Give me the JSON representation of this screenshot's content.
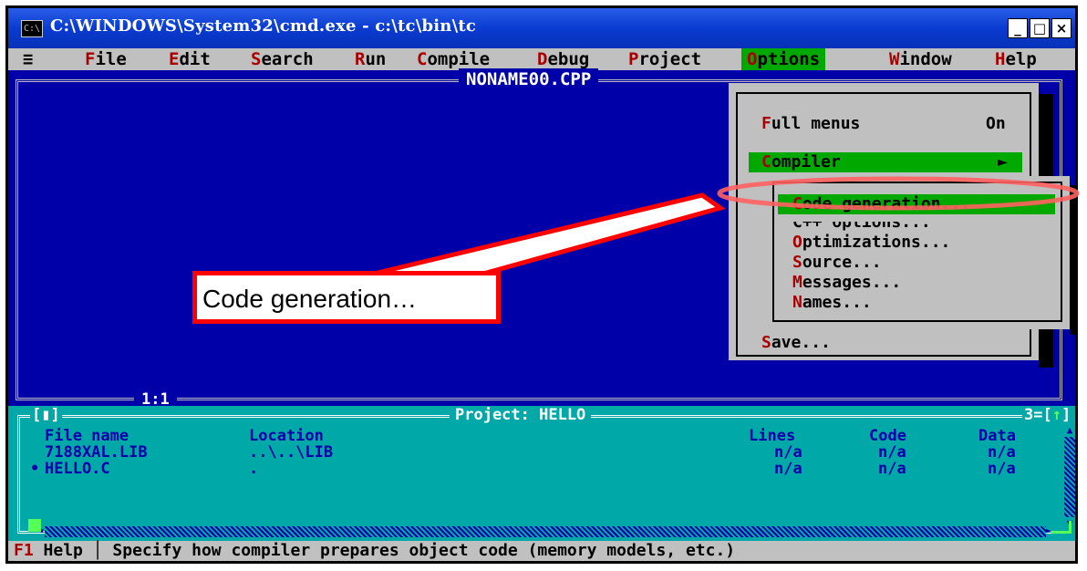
{
  "window": {
    "icon_label": "C:\\",
    "title": "C:\\WINDOWS\\System32\\cmd.exe - c:\\tc\\bin\\tc",
    "min_label": "_",
    "max_label": "□",
    "close_label": "×"
  },
  "menu": {
    "system": "≡",
    "file": {
      "hk": "F",
      "rest": "ile"
    },
    "edit": {
      "hk": "E",
      "rest": "dit"
    },
    "search": {
      "hk": "S",
      "rest": "earch"
    },
    "run": {
      "hk": "R",
      "rest": "un"
    },
    "compile": {
      "hk": "C",
      "rest": "ompile"
    },
    "debug": {
      "hk": "D",
      "rest": "ebug"
    },
    "project": {
      "hk": "P",
      "rest": "roject"
    },
    "options": {
      "hk": "O",
      "rest": "ptions"
    },
    "window": {
      "hk": "W",
      "rest": "indow"
    },
    "help": {
      "hk": "H",
      "rest": "elp"
    }
  },
  "editor": {
    "title": "NONAME00.CPP",
    "position": "1:1"
  },
  "options_menu": {
    "full_menus": {
      "hk": "F",
      "rest": "ull menus",
      "value": "On"
    },
    "compiler": {
      "hk": "C",
      "rest": "ompiler",
      "arrow": "►"
    },
    "save": {
      "hk": "S",
      "rest": "ave..."
    }
  },
  "compiler_submenu": {
    "code_generation": {
      "hk": "C",
      "rest": "ode generation..."
    },
    "cpp_options": {
      "text": "C++ options..."
    },
    "optimizations": {
      "hk": "O",
      "rest": "ptimizations..."
    },
    "source": {
      "hk": "S",
      "rest": "ource..."
    },
    "messages": {
      "hk": "M",
      "rest": "essages..."
    },
    "names": {
      "hk": "N",
      "rest": "ames..."
    }
  },
  "project": {
    "left_tag": "[▮]",
    "title": "Project: HELLO",
    "right_tag": {
      "num": "3=[",
      "arrow": "↑",
      "close": "]"
    },
    "columns": {
      "file": "File name",
      "location": "Location",
      "lines": "Lines",
      "code": "Code",
      "data": "Data"
    },
    "rows": [
      {
        "marker": "",
        "file": "7188XAL.LIB",
        "location": "..\\..\\LIB",
        "lines": "n/a",
        "code": "n/a",
        "data": "n/a"
      },
      {
        "marker": "•",
        "file": "HELLO.C",
        "location": ".",
        "lines": "n/a",
        "code": "n/a",
        "data": "n/a"
      }
    ]
  },
  "status": {
    "key": "F1",
    "label": "Help",
    "message": "Specify how compiler prepares object code (memory models, etc.)"
  },
  "callout": {
    "text": "Code generation…",
    "color": "#ff0000"
  }
}
